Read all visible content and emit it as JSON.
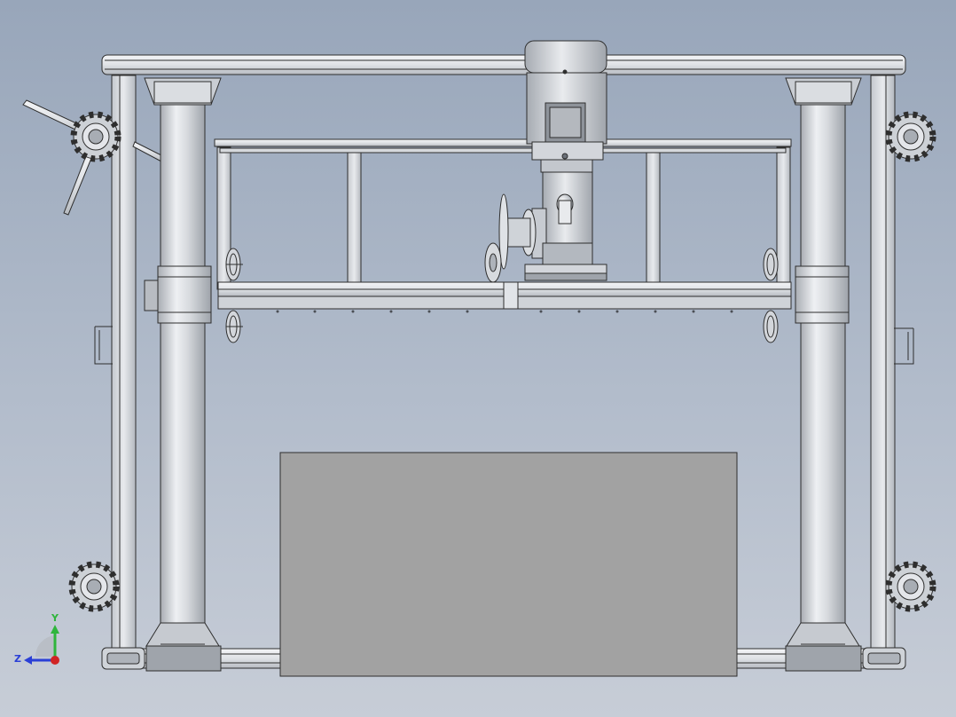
{
  "viewport": {
    "background_top": "#98a6ba",
    "background_bottom": "#c7cdd7"
  },
  "triad": {
    "y_label": "Y",
    "z_label": "Z",
    "y_color": "#2fb53c",
    "z_color": "#2a3fd6",
    "x_color": "#d12424"
  },
  "colors": {
    "steel_light": "#e6e8ec",
    "steel_mid": "#c9cdd3",
    "steel_dark": "#9fa4ab",
    "outline": "#2e2e2e",
    "box_fill": "#a2a2a2"
  },
  "icons": [
    "sprocket-icon",
    "axis-triad-icon"
  ]
}
